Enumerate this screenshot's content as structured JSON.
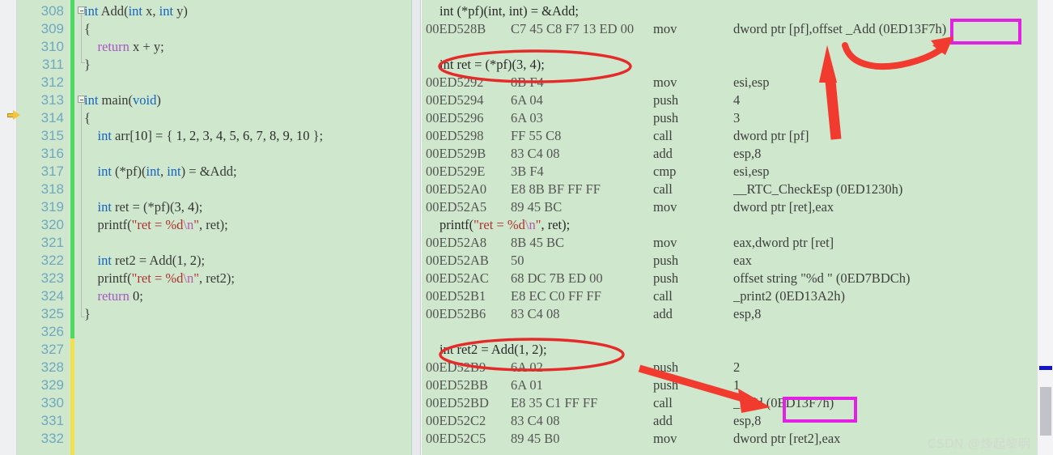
{
  "editor": {
    "first_line_number": 308,
    "line_count": 24,
    "current_line_marker_line": 314,
    "lines": [
      {
        "n": 308,
        "text": "int Add(int x, int y)"
      },
      {
        "n": 309,
        "text": "{"
      },
      {
        "n": 310,
        "text": "    return x + y;"
      },
      {
        "n": 311,
        "text": "}"
      },
      {
        "n": 312,
        "text": ""
      },
      {
        "n": 313,
        "text": "int main(void)"
      },
      {
        "n": 314,
        "text": "{"
      },
      {
        "n": 315,
        "text": "    int arr[10] = { 1, 2, 3, 4, 5, 6, 7, 8, 9, 10 };"
      },
      {
        "n": 316,
        "text": ""
      },
      {
        "n": 317,
        "text": "    int (*pf)(int, int) = &Add;"
      },
      {
        "n": 318,
        "text": ""
      },
      {
        "n": 319,
        "text": "    int ret = (*pf)(3, 4);"
      },
      {
        "n": 320,
        "text": "    printf(\"ret = %d\\n\", ret);"
      },
      {
        "n": 321,
        "text": ""
      },
      {
        "n": 322,
        "text": "    int ret2 = Add(1, 2);"
      },
      {
        "n": 323,
        "text": "    printf(\"ret = %d\\n\", ret2);"
      },
      {
        "n": 324,
        "text": "    return 0;"
      },
      {
        "n": 325,
        "text": "}"
      },
      {
        "n": 326,
        "text": ""
      },
      {
        "n": 327,
        "text": ""
      },
      {
        "n": 328,
        "text": ""
      },
      {
        "n": 329,
        "text": ""
      },
      {
        "n": 330,
        "text": ""
      },
      {
        "n": 331,
        "text": ""
      },
      {
        "n": 332,
        "text": ""
      }
    ]
  },
  "disassembly": {
    "rows": [
      {
        "kind": "source",
        "src": "int (*pf)(int, int) = &Add;"
      },
      {
        "kind": "asm",
        "addr": "00ED528B",
        "bytes": "C7 45 C8 F7 13 ED 00",
        "mnemonic": "mov",
        "operands": "dword ptr [pf],offset _Add (0ED13F7h)"
      },
      {
        "kind": "blank"
      },
      {
        "kind": "source",
        "src": "int ret = (*pf)(3, 4);"
      },
      {
        "kind": "asm",
        "addr": "00ED5292",
        "bytes": "8B F4",
        "mnemonic": "mov",
        "operands": "esi,esp"
      },
      {
        "kind": "asm",
        "addr": "00ED5294",
        "bytes": "6A 04",
        "mnemonic": "push",
        "operands": "4"
      },
      {
        "kind": "asm",
        "addr": "00ED5296",
        "bytes": "6A 03",
        "mnemonic": "push",
        "operands": "3"
      },
      {
        "kind": "asm",
        "addr": "00ED5298",
        "bytes": "FF 55 C8",
        "mnemonic": "call",
        "operands": "dword ptr [pf]"
      },
      {
        "kind": "asm",
        "addr": "00ED529B",
        "bytes": "83 C4 08",
        "mnemonic": "add",
        "operands": "esp,8"
      },
      {
        "kind": "asm",
        "addr": "00ED529E",
        "bytes": "3B F4",
        "mnemonic": "cmp",
        "operands": "esi,esp"
      },
      {
        "kind": "asm",
        "addr": "00ED52A0",
        "bytes": "E8 8B BF FF FF",
        "mnemonic": "call",
        "operands": "__RTC_CheckEsp (0ED1230h)"
      },
      {
        "kind": "asm",
        "addr": "00ED52A5",
        "bytes": "89 45 BC",
        "mnemonic": "mov",
        "operands": "dword ptr [ret],eax"
      },
      {
        "kind": "source",
        "src": "printf(\"ret = %d\\n\", ret);"
      },
      {
        "kind": "asm",
        "addr": "00ED52A8",
        "bytes": "8B 45 BC",
        "mnemonic": "mov",
        "operands": "eax,dword ptr [ret]"
      },
      {
        "kind": "asm",
        "addr": "00ED52AB",
        "bytes": "50",
        "mnemonic": "push",
        "operands": "eax"
      },
      {
        "kind": "asm",
        "addr": "00ED52AC",
        "bytes": "68 DC 7B ED 00",
        "mnemonic": "push",
        "operands": "offset string \"%d \" (0ED7BDCh)"
      },
      {
        "kind": "asm",
        "addr": "00ED52B1",
        "bytes": "E8 EC C0 FF FF",
        "mnemonic": "call",
        "operands": "_print2 (0ED13A2h)"
      },
      {
        "kind": "asm",
        "addr": "00ED52B6",
        "bytes": "83 C4 08",
        "mnemonic": "add",
        "operands": "esp,8"
      },
      {
        "kind": "blank"
      },
      {
        "kind": "source",
        "src": "int ret2 = Add(1, 2);"
      },
      {
        "kind": "asm",
        "addr": "00ED52B9",
        "bytes": "6A 02",
        "mnemonic": "push",
        "operands": "2"
      },
      {
        "kind": "asm",
        "addr": "00ED52BB",
        "bytes": "6A 01",
        "mnemonic": "push",
        "operands": "1"
      },
      {
        "kind": "asm",
        "addr": "00ED52BD",
        "bytes": "E8 35 C1 FF FF",
        "mnemonic": "call",
        "operands": "_Add (0ED13F7h)"
      },
      {
        "kind": "asm",
        "addr": "00ED52C2",
        "bytes": "83 C4 08",
        "mnemonic": "add",
        "operands": "esp,8"
      },
      {
        "kind": "asm",
        "addr": "00ED52C5",
        "bytes": "89 45 B0",
        "mnemonic": "mov",
        "operands": "dword ptr [ret2],eax"
      }
    ]
  },
  "annotations": {
    "highlight_boxes": [
      {
        "name": "highlight-box-add-address-top",
        "label": "0ED13F7h",
        "color": "#e222e2"
      },
      {
        "name": "highlight-box-add-address-bottom",
        "label": "0ED13F7h",
        "color": "#e222e2"
      }
    ],
    "ellipses": [
      {
        "name": "ellipse-int-ret-statement",
        "target": "int ret = (*pf)(3, 4);",
        "color": "#e52a2a"
      },
      {
        "name": "ellipse-int-ret2-statement",
        "target": "int ret2 = Add(1, 2);",
        "color": "#e52a2a"
      }
    ],
    "arrows": [
      {
        "name": "arrow-up-to-pf",
        "color": "#f23b2f"
      },
      {
        "name": "arrow-curve-to-add-address",
        "color": "#f23b2f"
      },
      {
        "name": "arrow-to-add-call",
        "color": "#f23b2f"
      }
    ]
  },
  "watermark": {
    "text": "CSDN @烽起黎明"
  },
  "scrollbar": {
    "marker_color": "#1414c8",
    "thumb_color": "#c2c3c8"
  },
  "colors": {
    "editor_background": "#cfe7cc",
    "line_number": "#6fa8bf",
    "keyword": "#1564c0",
    "string": "#b03030",
    "change_bar_unsaved": "#4cd964",
    "change_bar_saved": "#f2e14c",
    "annotation_red": "#e52a2a",
    "annotation_magenta": "#e222e2"
  }
}
